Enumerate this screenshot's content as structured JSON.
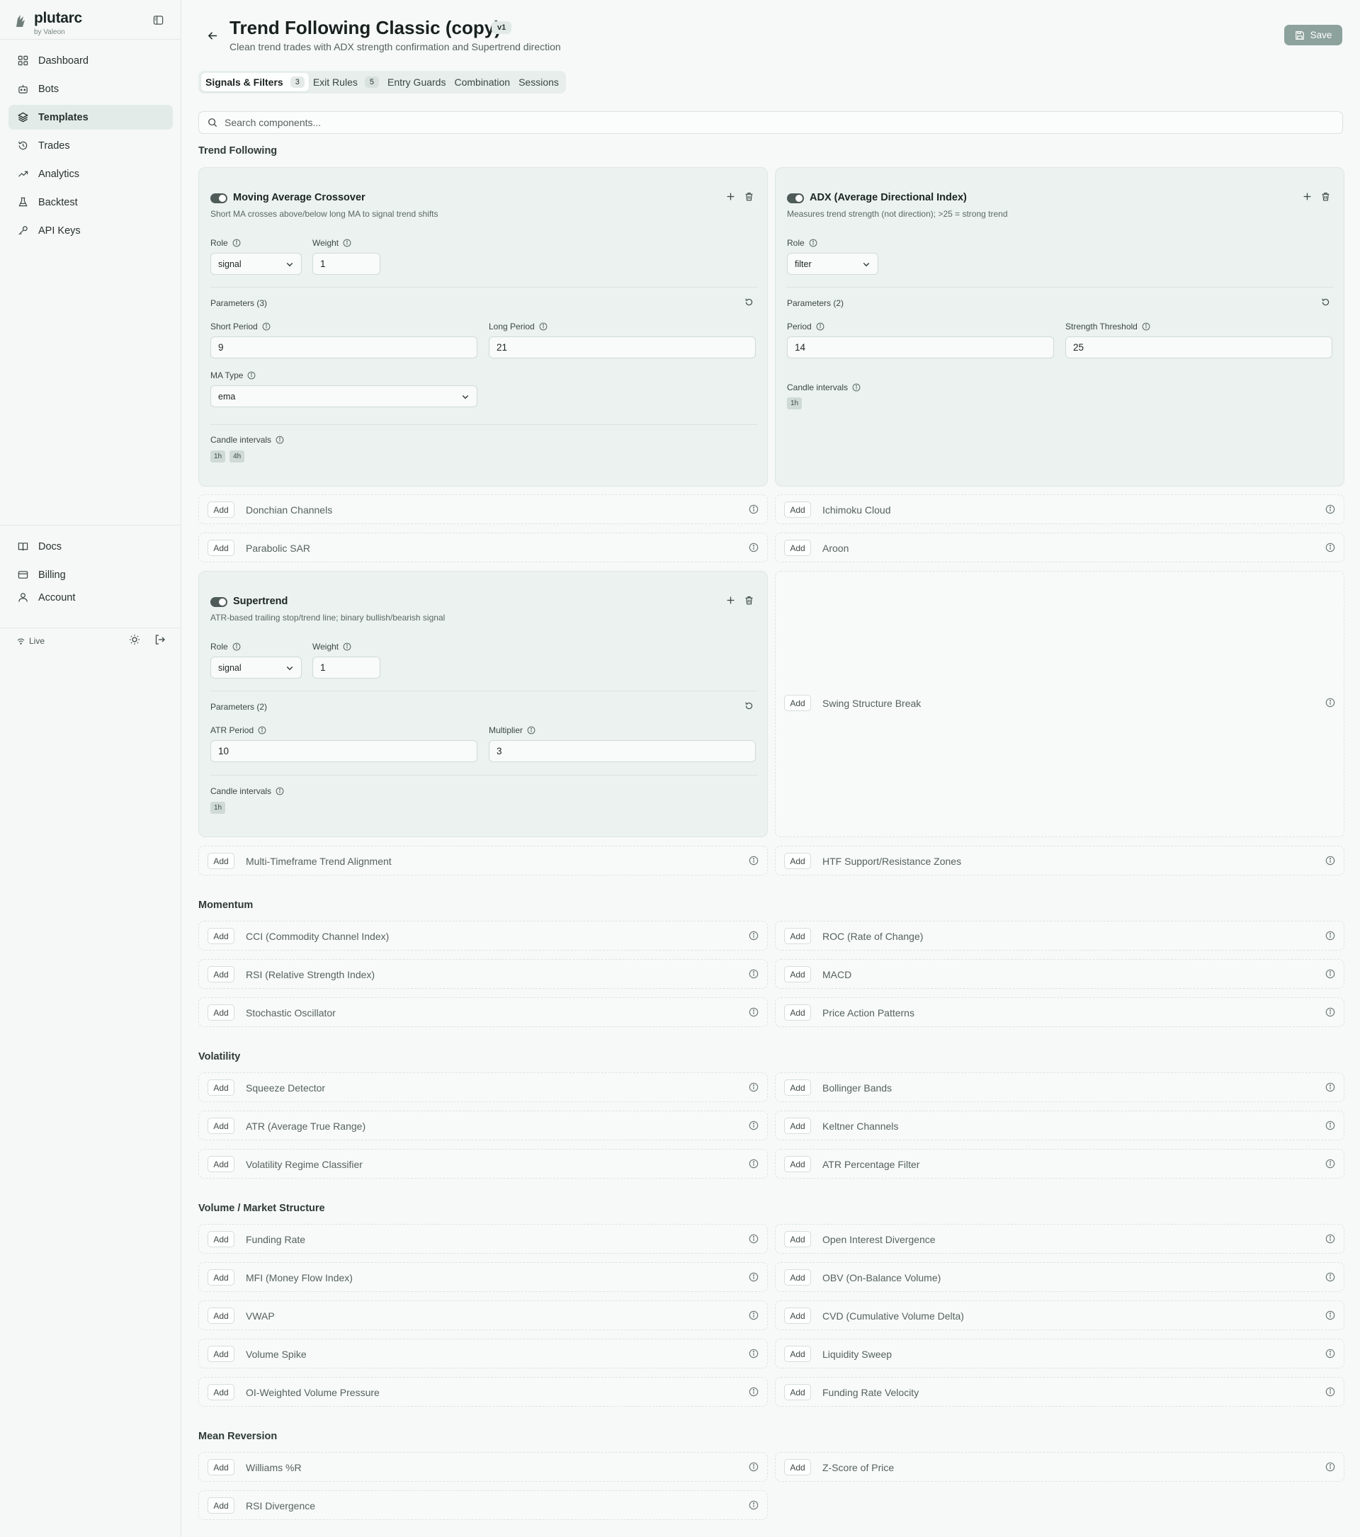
{
  "app": {
    "name": "plutarc",
    "byline": "by Valeon"
  },
  "sidebar": {
    "items": [
      {
        "label": "Dashboard",
        "icon": "dashboard-icon"
      },
      {
        "label": "Bots",
        "icon": "bot-icon"
      },
      {
        "label": "Templates",
        "icon": "layers-icon",
        "active": true
      },
      {
        "label": "Trades",
        "icon": "history-icon"
      },
      {
        "label": "Analytics",
        "icon": "trending-up-icon"
      },
      {
        "label": "Backtest",
        "icon": "flask-icon"
      },
      {
        "label": "API Keys",
        "icon": "key-icon"
      }
    ],
    "bottom_items": [
      {
        "label": "Docs",
        "icon": "book-icon"
      },
      {
        "label": "Billing",
        "icon": "credit-card-icon"
      },
      {
        "label": "Account",
        "icon": "user-icon"
      }
    ],
    "status": "Live"
  },
  "header": {
    "title": "Trend Following Classic (copy)",
    "version": "v1",
    "subtitle": "Clean trend trades with ADX strength confirmation and Supertrend direction",
    "save_label": "Save"
  },
  "tabs": [
    {
      "label": "Signals & Filters",
      "count": "3",
      "active": true
    },
    {
      "label": "Exit Rules",
      "count": "5"
    },
    {
      "label": "Entry Guards"
    },
    {
      "label": "Combination"
    },
    {
      "label": "Sessions"
    }
  ],
  "search": {
    "placeholder": "Search components..."
  },
  "add_label": "Add",
  "sections": {
    "trend": "Trend Following",
    "momentum": "Momentum",
    "volatility": "Volatility",
    "volume": "Volume / Market Structure",
    "mean_reversion": "Mean Reversion"
  },
  "cards": {
    "mac": {
      "name": "Moving Average Crossover",
      "desc": "Short MA crosses above/below long MA to signal trend shifts",
      "role_label": "Role",
      "role": "signal",
      "weight_label": "Weight",
      "weight": "1",
      "params_title": "Parameters (3)",
      "p1_label": "Short Period",
      "p1": "9",
      "p2_label": "Long Period",
      "p2": "21",
      "p3_label": "MA Type",
      "p3": "ema",
      "intervals_label": "Candle intervals",
      "intervals": [
        "1h",
        "4h"
      ]
    },
    "adx": {
      "name": "ADX (Average Directional Index)",
      "desc": "Measures trend strength (not direction); >25 = strong trend",
      "role_label": "Role",
      "role": "filter",
      "params_title": "Parameters (2)",
      "p1_label": "Period",
      "p1": "14",
      "p2_label": "Strength Threshold",
      "p2": "25",
      "intervals_label": "Candle intervals",
      "intervals": [
        "1h"
      ]
    },
    "st": {
      "name": "Supertrend",
      "desc": "ATR-based trailing stop/trend line; binary bullish/bearish signal",
      "role_label": "Role",
      "role": "signal",
      "weight_label": "Weight",
      "weight": "1",
      "params_title": "Parameters (2)",
      "p1_label": "ATR Period",
      "p1": "10",
      "p2_label": "Multiplier",
      "p2": "3",
      "intervals_label": "Candle intervals",
      "intervals": [
        "1h"
      ]
    }
  },
  "components": {
    "trend_left": [
      "Donchian Channels",
      "Parabolic SAR"
    ],
    "trend_right": [
      "Ichimoku Cloud",
      "Aroon"
    ],
    "swing": "Swing Structure Break",
    "trend_last_left": "Multi-Timeframe Trend Alignment",
    "trend_last_right": "HTF Support/Resistance Zones",
    "momentum": [
      [
        "CCI (Commodity Channel Index)",
        "ROC (Rate of Change)"
      ],
      [
        "RSI (Relative Strength Index)",
        "MACD"
      ],
      [
        "Stochastic Oscillator",
        "Price Action Patterns"
      ]
    ],
    "volatility": [
      [
        "Squeeze Detector",
        "Bollinger Bands"
      ],
      [
        "ATR (Average True Range)",
        "Keltner Channels"
      ],
      [
        "Volatility Regime Classifier",
        "ATR Percentage Filter"
      ]
    ],
    "volume": [
      [
        "Funding Rate",
        "Open Interest Divergence"
      ],
      [
        "MFI (Money Flow Index)",
        "OBV (On-Balance Volume)"
      ],
      [
        "VWAP",
        "CVD (Cumulative Volume Delta)"
      ],
      [
        "Volume Spike",
        "Liquidity Sweep"
      ],
      [
        "OI-Weighted Volume Pressure",
        "Funding Rate Velocity"
      ]
    ],
    "mean_reversion": [
      [
        "Williams %R",
        "Z-Score of Price"
      ],
      [
        "RSI Divergence"
      ]
    ]
  },
  "colors": {
    "accent": "#4f5b58",
    "card_bg": "#ebf2ef",
    "save_bg": "#8da29c"
  }
}
